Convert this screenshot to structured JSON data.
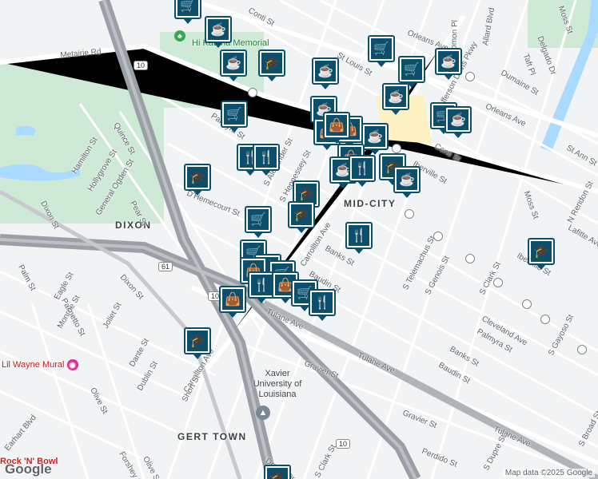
{
  "map": {
    "areas": [
      {
        "label": "DIXON"
      },
      {
        "label": "MID-CITY"
      },
      {
        "label": "GERT TOWN"
      }
    ],
    "streets": [
      "Metairie Rd",
      "Orleans Ave",
      "Orleans Ave",
      "Tulane Ave",
      "Tulane Ave",
      "Tulane Ave",
      "Carrollton Ave",
      "Carrollton Ave",
      "Iberville St",
      "Iberville St",
      "Conti St",
      "Conti St",
      "St Louis St",
      "D'Hemecourt St",
      "Banks St",
      "Banks St",
      "Baudin St",
      "Baudin St",
      "Gravier St",
      "Gravier St",
      "Palmetto St",
      "Dixon St",
      "Dixon St",
      "Quince St",
      "Hamilton St",
      "Hollygrove St",
      "General Ogden St",
      "Pear St",
      "Palm St",
      "Eagle St",
      "Monroe St",
      "Joliet St",
      "Dante St",
      "Dublin St",
      "Olive St",
      "Olive St",
      "Short St",
      "Earhart Blvd",
      "Drexel Dr",
      "Forshey St",
      "Perdido St",
      "S Clark St",
      "S Clark St",
      "S Telemachus St",
      "S Genois St",
      "S Dupre St",
      "S Gayoso St",
      "Cleveland Ave",
      "Palmyra St",
      "Moss St",
      "Moss St",
      "Delgado Dr",
      "Taft Pl",
      "Dumaine St",
      "Allard Blvd",
      "Solomon Pl",
      "N Rendon St",
      "Lafitte Ave",
      "St Ann St",
      "S Broad St",
      "S Alexander St",
      "S Hennessey St",
      "Palmyra St",
      "Jefferson Davis Pkwy"
    ],
    "highways": [
      "10",
      "10",
      "61",
      "10"
    ],
    "pois": [
      {
        "name": "Lil Wayne Mural"
      },
      {
        "name": "Xavier University of Louisiana"
      },
      {
        "name": "Rock 'N' Bowl"
      },
      {
        "name": "Hi Katrina Memorial"
      }
    ],
    "markers": [
      {
        "type": "shopping-cart"
      },
      {
        "type": "coffee-cup"
      },
      {
        "type": "coffee-cup"
      },
      {
        "type": "graduation-cap"
      },
      {
        "type": "graduation-cap"
      },
      {
        "type": "shopping-cart"
      },
      {
        "type": "shopping-cart"
      },
      {
        "type": "coffee-cup"
      },
      {
        "type": "coffee-cup"
      },
      {
        "type": "coffee-cup"
      },
      {
        "type": "coffee-cup"
      },
      {
        "type": "shopping-cart"
      },
      {
        "type": "shopping-cart"
      },
      {
        "type": "coffee-cup"
      },
      {
        "type": "shopping-bag"
      },
      {
        "type": "shopping-bag"
      },
      {
        "type": "shopping-bag"
      },
      {
        "type": "coffee-cup"
      },
      {
        "type": "fork-knife"
      },
      {
        "type": "fork-knife"
      },
      {
        "type": "shopping-bag"
      },
      {
        "type": "graduation-cap"
      },
      {
        "type": "coffee-cup"
      },
      {
        "type": "coffee-cup"
      },
      {
        "type": "fork-knife"
      },
      {
        "type": "graduation-cap"
      },
      {
        "type": "graduation-cap"
      },
      {
        "type": "shopping-cart"
      },
      {
        "type": "fork-knife"
      },
      {
        "type": "shopping-cart"
      },
      {
        "type": "fork-knife"
      },
      {
        "type": "shopping-bag"
      },
      {
        "type": "shopping-cart"
      },
      {
        "type": "fork-knife"
      },
      {
        "type": "shopping-bag"
      },
      {
        "type": "graduation-cap"
      },
      {
        "type": "graduation-cap"
      },
      {
        "type": "shopping-cart"
      },
      {
        "type": "graduation-cap"
      },
      {
        "type": "shopping-bag"
      },
      {
        "type": "fork-knife"
      }
    ],
    "attribution": "Map data ©2025 Google",
    "logo": "Google"
  },
  "icon_glyphs": {
    "shopping-cart": "🛒",
    "coffee-cup": "☕",
    "graduation-cap": "🎓",
    "shopping-bag": "👜",
    "fork-knife": "🍴"
  },
  "colors": {
    "marker": "#0b4f6c",
    "highway": "#9aa0a6",
    "water": "#aadaff",
    "park": "#ceead6"
  }
}
